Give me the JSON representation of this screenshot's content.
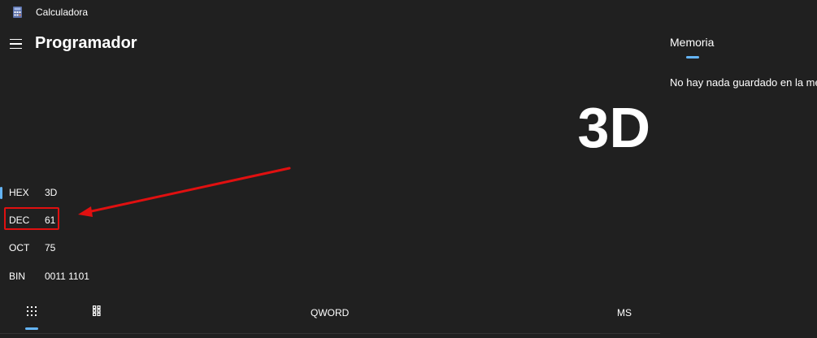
{
  "titlebar": {
    "app_icon": "calculator-icon",
    "title": "Calculadora"
  },
  "header": {
    "menu_icon": "hamburger-menu-icon",
    "mode_title": "Programador"
  },
  "display": {
    "value": "3D"
  },
  "radix": [
    {
      "label": "HEX",
      "value": "3D",
      "selected": true
    },
    {
      "label": "DEC",
      "value": "61",
      "selected": false
    },
    {
      "label": "OCT",
      "value": "75",
      "selected": false
    },
    {
      "label": "BIN",
      "value": "0011 1101",
      "selected": false
    }
  ],
  "annotation": {
    "highlight_color": "#e01010",
    "target": "DEC"
  },
  "bottom_bar": {
    "keypad_icon": "full-keypad-icon",
    "bits_icon": "bit-toggling-keypad-icon",
    "word_size_label": "QWORD",
    "memory_store_label": "MS"
  },
  "memory_panel": {
    "tab_label": "Memoria",
    "empty_message": "No hay nada guardado en la memoria"
  },
  "colors": {
    "background": "#202020",
    "accent": "#64b4f6",
    "text": "#ffffff"
  }
}
